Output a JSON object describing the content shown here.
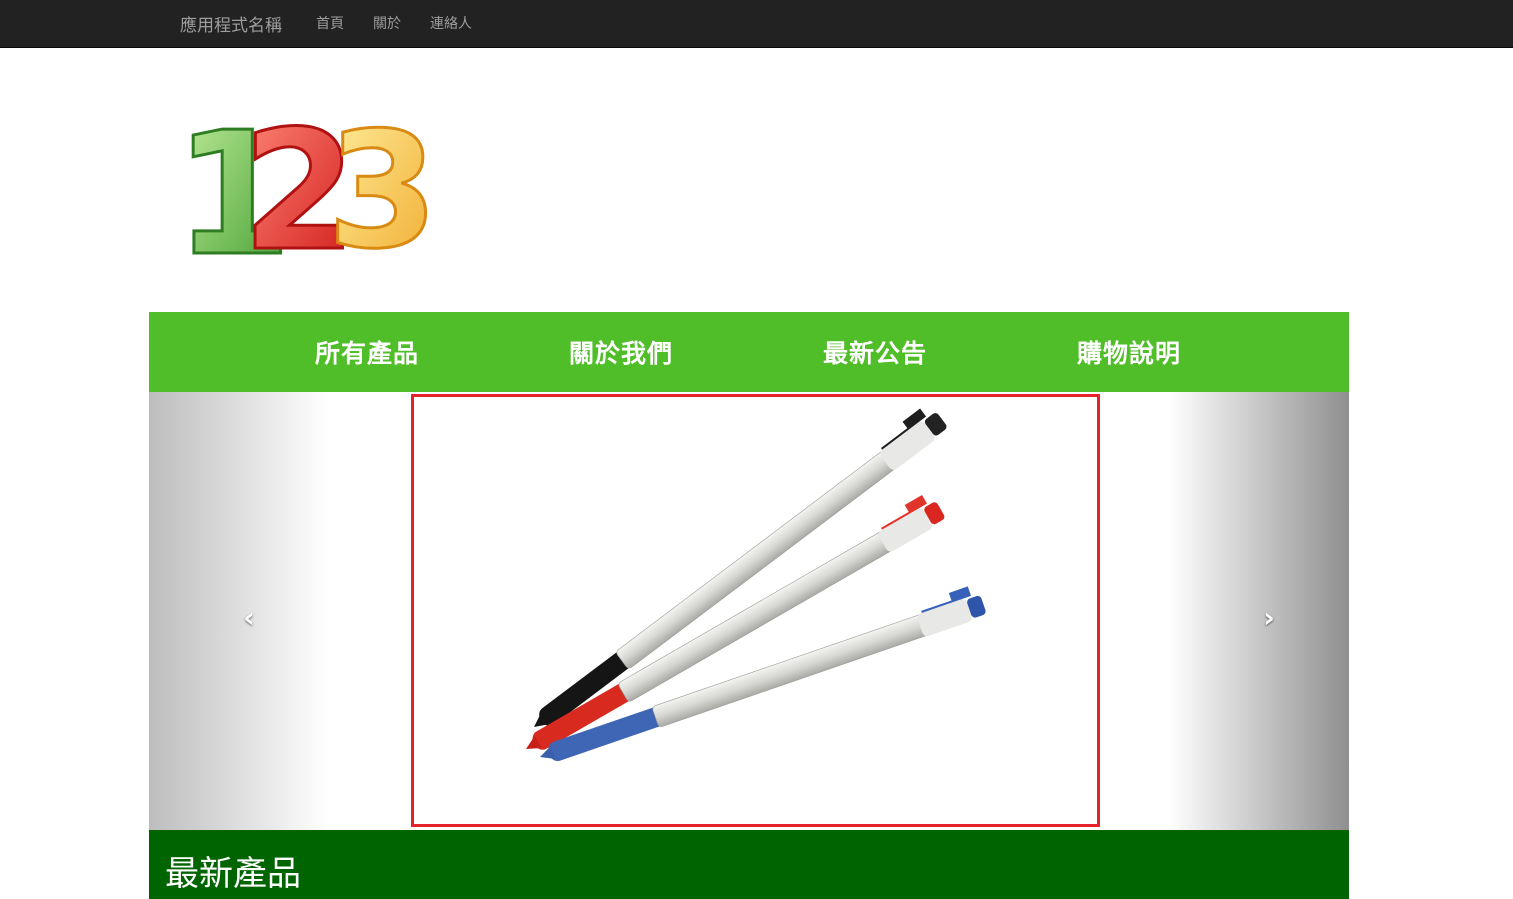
{
  "navbar": {
    "brand": "應用程式名稱",
    "links": [
      "首頁",
      "關於",
      "連絡人"
    ]
  },
  "logo": {
    "digits": [
      "1",
      "2",
      "3"
    ]
  },
  "categories": [
    "所有產品",
    "關於我們",
    "最新公告",
    "購物說明"
  ],
  "carousel": {
    "prev_icon": "chevron-left-icon",
    "next_icon": "chevron-right-icon",
    "prev_glyph": "‹",
    "next_glyph": "›",
    "slide_alt": "ballpoint pens"
  },
  "section": {
    "title": "最新產品"
  },
  "colors": {
    "topbar": "#222222",
    "category_bar": "#50be28",
    "section_bar": "#006400",
    "slide_border": "#e3222b"
  }
}
